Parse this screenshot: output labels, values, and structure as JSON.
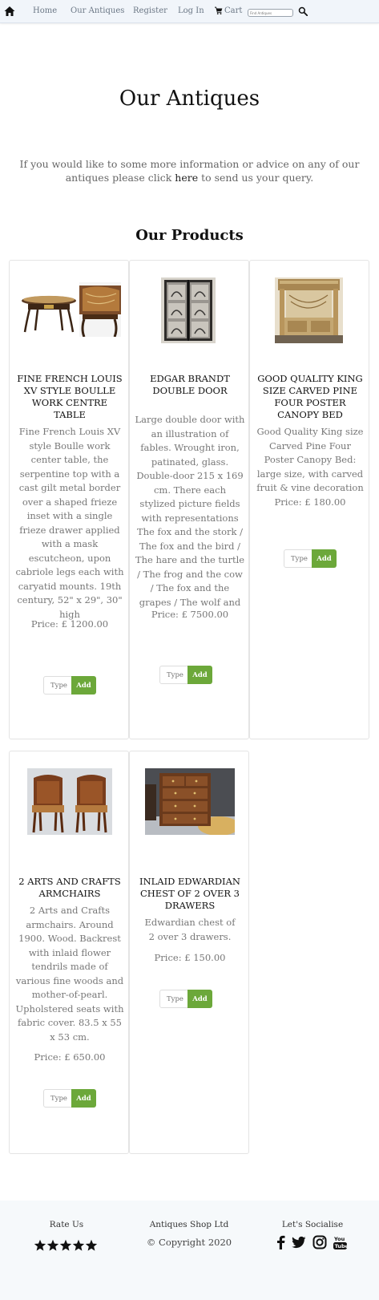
{
  "nav": {
    "home_icon": "home-icon",
    "links": [
      "Home",
      "Our Antiques",
      "Register",
      "Log In"
    ],
    "cart_label": "Cart",
    "cart_icon": "cart-icon",
    "search_placeholder": "Find Antiques",
    "search_icon": "search-icon"
  },
  "hero": {
    "title": "Our Antiques",
    "intro_before": "If you would like to some more information or advice on any of our antiques please click ",
    "intro_link": "here",
    "intro_after": " to send us your query.",
    "section_title": "Our Products"
  },
  "products": [
    {
      "title": "Fine French Louis XV Style Boulle Work Centre Table",
      "description": "Fine French Louis XV style Boulle work center table, the serpentine top with a cast gilt metal border over a shaped frieze inset with a single frieze drawer applied with a mask escutcheon, upon cabriole legs each with caryatid mounts. 19th century, 52\" x 29\", 30\" high",
      "price": "Price: £ 1200.00",
      "qty_placeholder": "Type",
      "add_label": "Add",
      "image": "boulle-table-photo"
    },
    {
      "title": "Edgar Brandt Double Door",
      "description": "Large double door with an illustration of fables. Wrought iron, patinated, glass. Double-door 215 x 169 cm. There each stylized picture fields with representations The fox and the stork / The fox and the bird / The hare and the turtle / The frog and the cow / The fox and the grapes / The wolf and the lamb.",
      "price": "Price: £ 7500.00",
      "qty_placeholder": "Type",
      "add_label": "Add",
      "image": "double-door-photo"
    },
    {
      "title": "Good Quality King Size Carved Pine Four Poster Canopy Bed",
      "description": "Good Quality King size Carved Pine Four Poster Canopy Bed: large size, with carved fruit & vine decoration",
      "price": "Price: £ 180.00",
      "qty_placeholder": "Type",
      "add_label": "Add",
      "image": "canopy-bed-photo"
    },
    {
      "title": "2 Arts and Crafts Armchairs",
      "description": "2 Arts and Crafts armchairs. Around 1900. Wood. Backrest with inlaid flower tendrils made of various fine woods and mother-of-pearl. Upholstered seats with fabric cover. 83.5 x 55 x 53 cm.",
      "price": "Price: £ 650.00",
      "qty_placeholder": "Type",
      "add_label": "Add",
      "image": "armchairs-photo"
    },
    {
      "title": "Inlaid Edwardian Chest of 2 over 3 Drawers",
      "description": "Edwardian chest of 2 over 3 drawers.",
      "price": "Price: £ 150.00",
      "qty_placeholder": "Type",
      "add_label": "Add",
      "image": "chest-of-drawers-photo"
    }
  ],
  "footer": {
    "rate_label": "Rate Us",
    "rating_stars": 5,
    "company": "Antiques Shop Ltd",
    "copyright": "© Copyright 2020",
    "social_label": "Let's Socialise",
    "social_icons": [
      "facebook-icon",
      "twitter-icon",
      "instagram-icon",
      "youtube-icon"
    ]
  },
  "colors": {
    "navbar_bg": "#f1f5fa",
    "add_button": "#6ca83a",
    "footer_bg": "#f6f9fb"
  }
}
